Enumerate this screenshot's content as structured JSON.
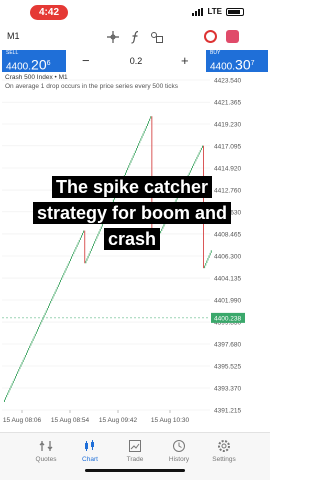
{
  "status_bar": {
    "time": "4:42",
    "network": "LTE"
  },
  "toolbar": {
    "symbol": "M1"
  },
  "trade": {
    "sell_label": "SELL",
    "sell_price_main": "4400.",
    "sell_price_big": "20",
    "sell_price_sup": "6",
    "buy_label": "BUY",
    "buy_price_main": "4400.",
    "buy_price_big": "30",
    "buy_price_sup": "7",
    "lot": "0.2",
    "minus": "−",
    "plus": "+"
  },
  "chart": {
    "title": "Crash 500 Index • M1",
    "description": "On average 1 drop occurs in the price series every 500 ticks",
    "price_ticks": [
      "4423.540",
      "4421.365",
      "4419.230",
      "4417.095",
      "4414.920",
      "4412.760",
      "4410.630",
      "4408.465",
      "4406.300",
      "4404.135",
      "4401.990",
      "4399.830",
      "4397.680",
      "4395.525",
      "4393.370",
      "4391.215"
    ],
    "current_price": "4400.238",
    "time_ticks": [
      "15 Aug 08:06",
      "15 Aug 08:54",
      "15 Aug 09:42",
      "15 Aug 10:30"
    ],
    "colors": {
      "bull": "#2e9d55",
      "bear": "#d64545",
      "price_line": "#3aa86b",
      "grid": "#eeeeee"
    }
  },
  "caption": {
    "line1": "The spike catcher",
    "line2": "strategy for boom and",
    "line3": "crash"
  },
  "nav": {
    "items": [
      {
        "label": "Quotes",
        "icon": "quotes-icon"
      },
      {
        "label": "Chart",
        "icon": "chart-icon"
      },
      {
        "label": "Trade",
        "icon": "trade-icon"
      },
      {
        "label": "History",
        "icon": "history-icon"
      },
      {
        "label": "Settings",
        "icon": "settings-icon"
      }
    ],
    "active": "Chart"
  }
}
